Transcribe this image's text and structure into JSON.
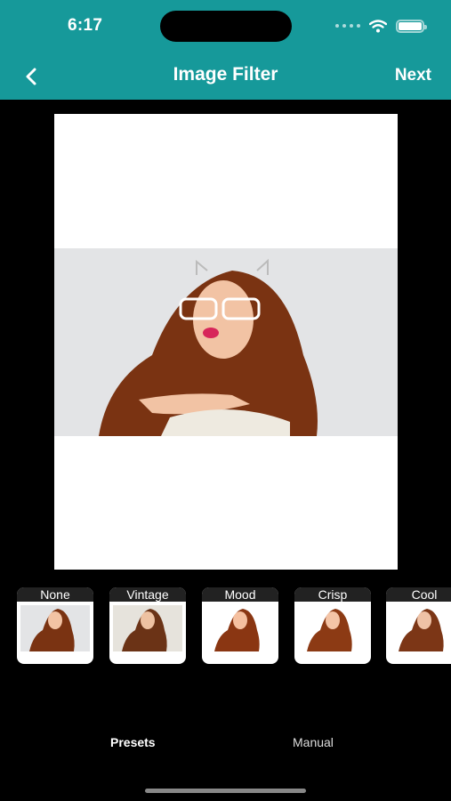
{
  "status_bar": {
    "time": "6:17"
  },
  "nav": {
    "title": "Image Filter",
    "next_label": "Next"
  },
  "presets": [
    {
      "label": "None"
    },
    {
      "label": "Vintage"
    },
    {
      "label": "Mood"
    },
    {
      "label": "Crisp"
    },
    {
      "label": "Cool"
    }
  ],
  "tabs": {
    "presets": "Presets",
    "manual": "Manual",
    "selected": "Presets"
  },
  "colors": {
    "header": "#16999a",
    "background": "#000000"
  }
}
